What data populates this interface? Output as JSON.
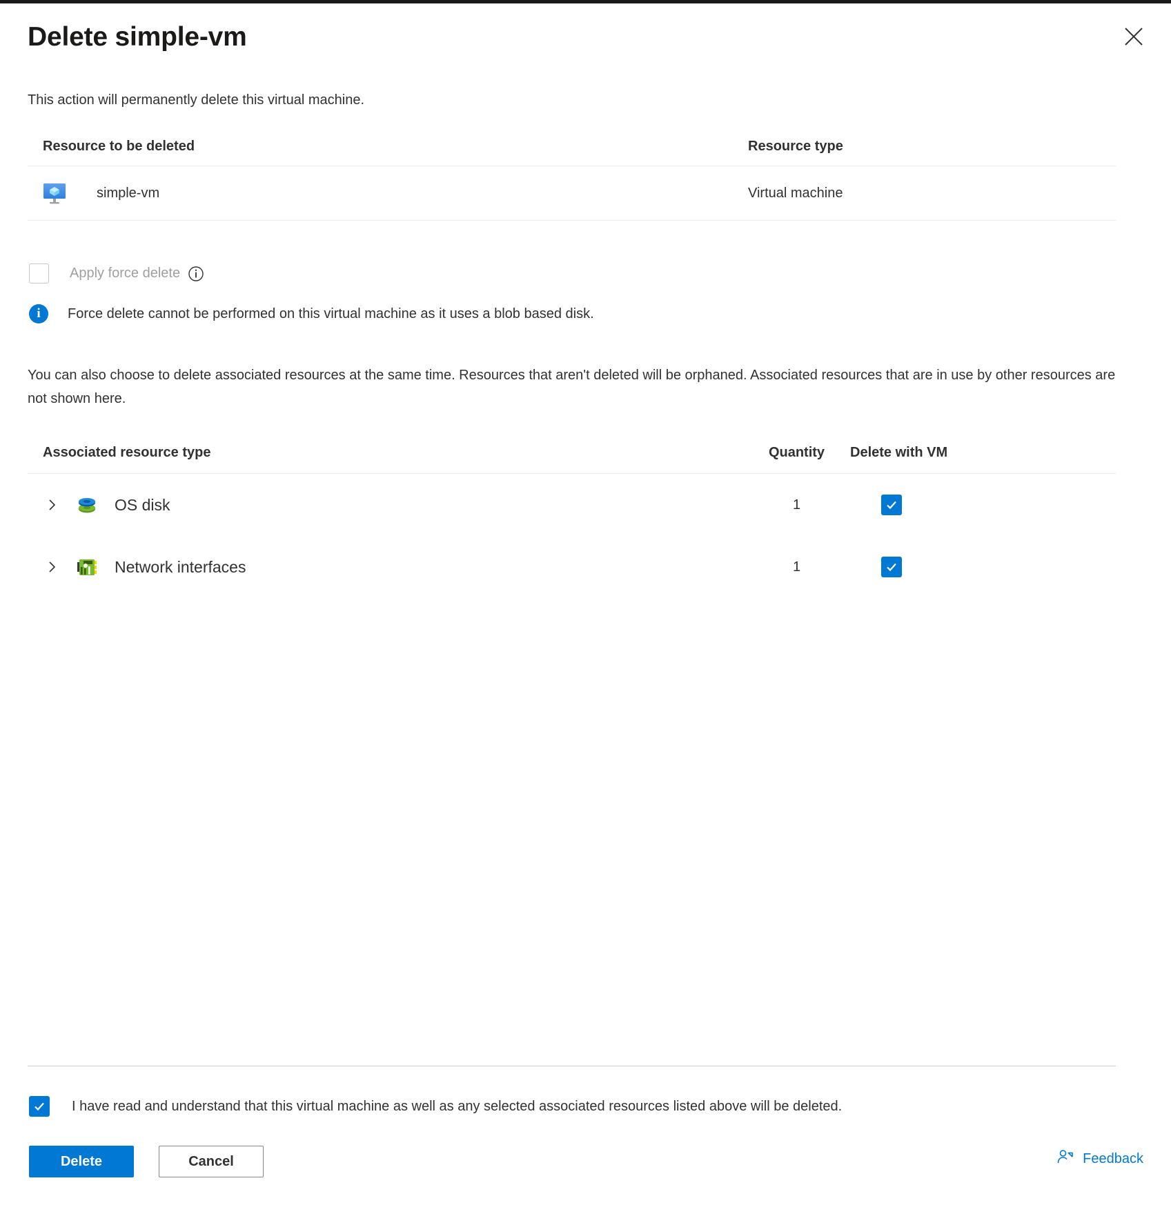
{
  "dialog": {
    "title": "Delete simple-vm",
    "close_label": "close-icon",
    "lead": "This action will permanently delete this virtual machine."
  },
  "resource_table": {
    "headers": {
      "name": "Resource to be deleted",
      "type": "Resource type"
    },
    "rows": [
      {
        "icon": "virtual-machine-icon",
        "name": "simple-vm",
        "type": "Virtual machine"
      }
    ]
  },
  "force_delete": {
    "label": "Apply force delete",
    "checked": false,
    "disabled": true,
    "info_icon": "info-outline-icon",
    "message_icon": "info-filled-icon",
    "message": "Force delete cannot be performed on this virtual machine as it uses a blob based disk."
  },
  "associated": {
    "description": "You can also choose to delete associated resources at the same time. Resources that aren't deleted will be orphaned. Associated resources that are in use by other resources are not shown here.",
    "headers": {
      "type": "Associated resource type",
      "quantity": "Quantity",
      "delete": "Delete with VM"
    },
    "rows": [
      {
        "expander": "chevron-right-icon",
        "icon": "disk-icon",
        "label": "OS disk",
        "quantity": "1",
        "delete_with_vm": true
      },
      {
        "expander": "chevron-right-icon",
        "icon": "network-interface-icon",
        "label": "Network interfaces",
        "quantity": "1",
        "delete_with_vm": true
      }
    ]
  },
  "footer": {
    "acknowledge": {
      "checked": true,
      "text": "I have read and understand that this virtual machine as well as any selected associated resources listed above will be deleted."
    },
    "delete_label": "Delete",
    "cancel_label": "Cancel",
    "feedback_label": "Feedback",
    "feedback_icon": "person-feedback-icon"
  },
  "colors": {
    "accent": "#0078d4",
    "text": "#323130",
    "disabled_text": "#a19f9d",
    "border": "#edebe9",
    "divider": "#d2d0ce"
  }
}
